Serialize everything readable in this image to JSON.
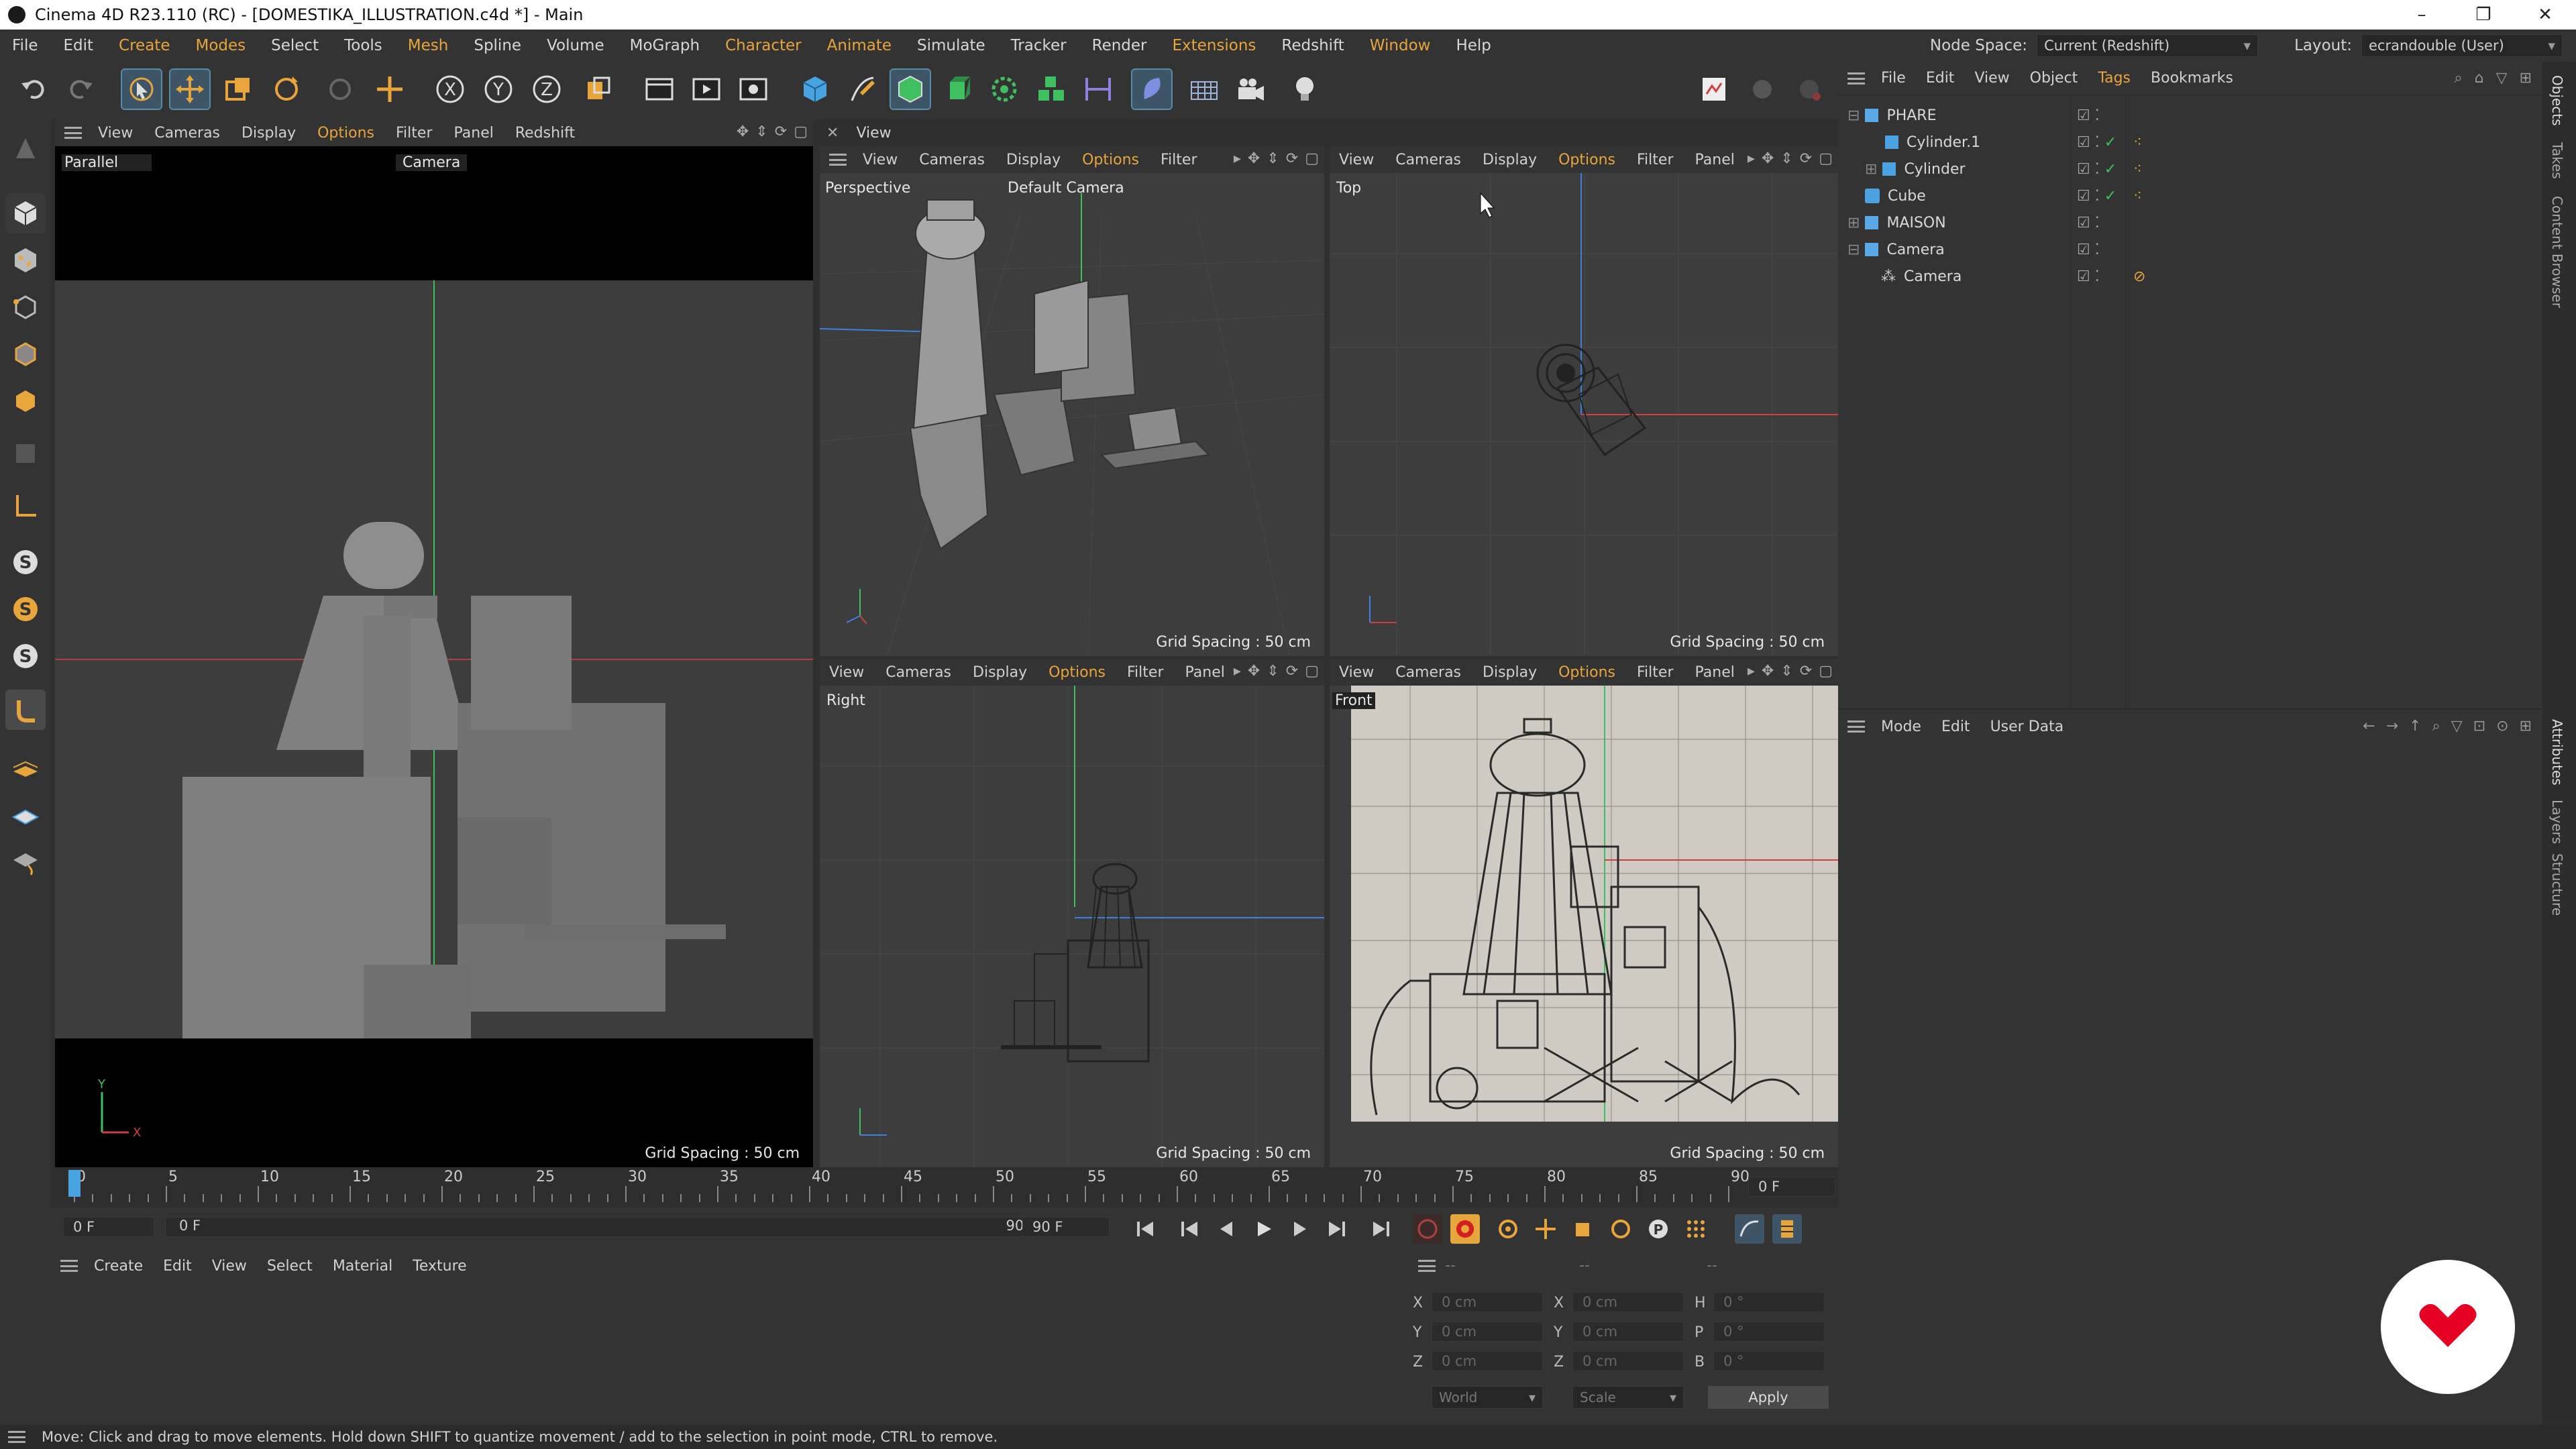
{
  "window": {
    "title": "Cinema 4D R23.110 (RC) - [DOMESTIKA_ILLUSTRATION.c4d *] - Main",
    "minimize": "–",
    "restore": "❐",
    "close": "✕"
  },
  "menu": {
    "items": [
      "File",
      "Edit",
      "Create",
      "Modes",
      "Select",
      "Tools",
      "Mesh",
      "Spline",
      "Volume",
      "MoGraph",
      "Character",
      "Animate",
      "Simulate",
      "Tracker",
      "Render",
      "Extensions",
      "Redshift",
      "Window",
      "Help"
    ],
    "node_space_label": "Node Space:",
    "node_space_value": "Current (Redshift)",
    "layout_label": "Layout:",
    "layout_value": "ecrandouble (User)"
  },
  "colors": {
    "accent": "#e8a53c",
    "x_axis": "#d04040",
    "y_axis": "#3fbf5f",
    "z_axis": "#3f7fdf",
    "brand": "#e60023"
  },
  "viewports": {
    "left": {
      "menu": [
        "View",
        "Cameras",
        "Display",
        "Options",
        "Filter",
        "Panel",
        "Redshift"
      ],
      "label": "Parallel",
      "camera": "Camera",
      "grid": "Grid Spacing : 50 cm"
    },
    "frame_title": "View",
    "perspective": {
      "menu": [
        "View",
        "Cameras",
        "Display",
        "Options",
        "Filter"
      ],
      "label": "Perspective",
      "camera": "Default Camera",
      "grid": "Grid Spacing : 50 cm"
    },
    "top": {
      "menu": [
        "View",
        "Cameras",
        "Display",
        "Options",
        "Filter",
        "Panel"
      ],
      "label": "Top",
      "grid": "Grid Spacing : 50 cm"
    },
    "right": {
      "menu": [
        "View",
        "Cameras",
        "Display",
        "Options",
        "Filter",
        "Panel"
      ],
      "label": "Right",
      "grid": "Grid Spacing : 50 cm"
    },
    "front": {
      "menu": [
        "View",
        "Cameras",
        "Display",
        "Options",
        "Filter",
        "Panel"
      ],
      "label": "Front",
      "grid": "Grid Spacing : 50 cm"
    }
  },
  "objects": {
    "menu": [
      "File",
      "Edit",
      "View",
      "Object",
      "Tags",
      "Bookmarks"
    ],
    "rows": [
      {
        "name": "PHARE"
      },
      {
        "name": "Cylinder.1"
      },
      {
        "name": "Cylinder"
      },
      {
        "name": "Cube"
      },
      {
        "name": "MAISON"
      },
      {
        "name": "Camera"
      },
      {
        "name": "Camera"
      }
    ]
  },
  "attributes": {
    "menu": [
      "Mode",
      "Edit",
      "User Data"
    ]
  },
  "right_tabs": [
    "Objects",
    "Takes",
    "Content Browser",
    "Attributes",
    "Layers",
    "Structure"
  ],
  "timeline": {
    "ticks": [
      "0",
      "5",
      "10",
      "15",
      "20",
      "25",
      "30",
      "35",
      "40",
      "45",
      "50",
      "55",
      "60",
      "65",
      "70",
      "75",
      "80",
      "85",
      "90"
    ],
    "end_frame": "0 F",
    "current": "0 F",
    "range_start": "0 F",
    "range_end": "90 F",
    "max": "90 F"
  },
  "materials": {
    "menu": [
      "Create",
      "Edit",
      "View",
      "Select",
      "Material",
      "Texture"
    ]
  },
  "coords": {
    "headers": [
      "--",
      "--",
      "--"
    ],
    "rows": [
      {
        "a": "X",
        "av": "0 cm",
        "b": "X",
        "bv": "0 cm",
        "c": "H",
        "cv": "0 °"
      },
      {
        "a": "Y",
        "av": "0 cm",
        "b": "Y",
        "bv": "0 cm",
        "c": "P",
        "cv": "0 °"
      },
      {
        "a": "Z",
        "av": "0 cm",
        "b": "Z",
        "bv": "0 cm",
        "c": "B",
        "cv": "0 °"
      }
    ],
    "space": "World",
    "mode": "Scale",
    "apply": "Apply"
  },
  "status": "Move: Click and drag to move elements. Hold down SHIFT to quantize movement / add to the selection in point mode, CTRL to remove."
}
